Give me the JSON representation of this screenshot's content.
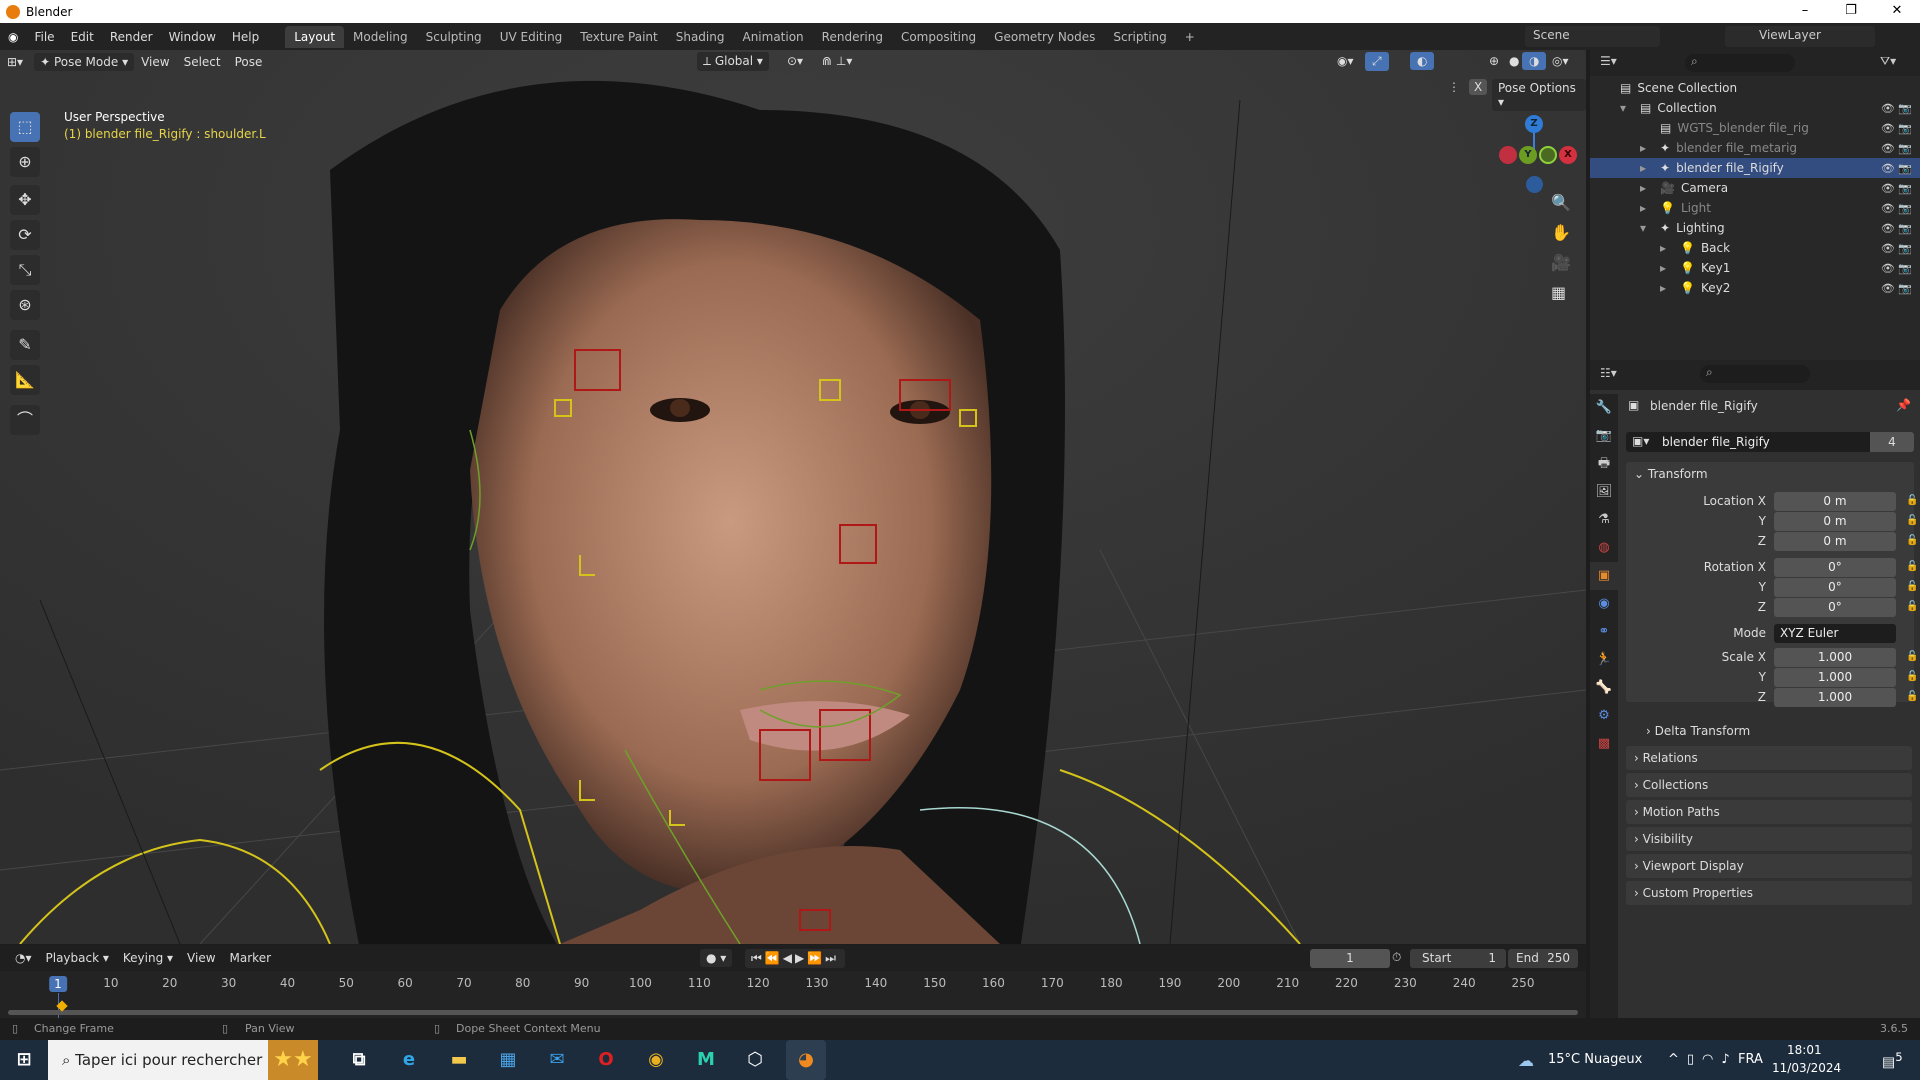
{
  "window": {
    "title": "Blender",
    "minimize": "–",
    "maximize": "❐",
    "close": "✕"
  },
  "menu": [
    "File",
    "Edit",
    "Render",
    "Window",
    "Help"
  ],
  "workspaces": [
    "Layout",
    "Modeling",
    "Sculpting",
    "UV Editing",
    "Texture Paint",
    "Shading",
    "Animation",
    "Rendering",
    "Compositing",
    "Geometry Nodes",
    "Scripting",
    "+"
  ],
  "scene": "Scene",
  "view_layer": "ViewLayer",
  "viewport": {
    "mode": "Pose Mode",
    "menus": [
      "View",
      "Select",
      "Pose"
    ],
    "orientation": "Global",
    "pose_options": "Pose Options",
    "mirror_x": "X",
    "overlay_title": "User Perspective",
    "overlay_subtitle": "(1) blender file_Rigify : shoulder.L",
    "gizmo": {
      "z": "Z",
      "y": "Y",
      "x": "X"
    }
  },
  "outliner": {
    "rows": [
      {
        "label": "Scene Collection",
        "indent": 0
      },
      {
        "label": "Collection",
        "indent": 1
      },
      {
        "label": "WGTS_blender file_rig",
        "indent": 2,
        "dim": true
      },
      {
        "label": "blender file_metarig",
        "indent": 2,
        "dim": true
      },
      {
        "label": "blender file_Rigify",
        "indent": 2,
        "selected": true
      },
      {
        "label": "Camera",
        "indent": 2
      },
      {
        "label": "Light",
        "indent": 2,
        "dim": true
      },
      {
        "label": "Lighting",
        "indent": 2
      },
      {
        "label": "Back",
        "indent": 3
      },
      {
        "label": "Key1",
        "indent": 3
      },
      {
        "label": "Key2",
        "indent": 3
      }
    ]
  },
  "properties": {
    "object_name": "blender file_Rigify",
    "data_name": "blender file_Rigify",
    "users": "4",
    "transform_label": "Transform",
    "fields": [
      {
        "label": "Location X",
        "value": "0 m"
      },
      {
        "label": "Y",
        "value": "0 m"
      },
      {
        "label": "Z",
        "value": "0 m"
      },
      {
        "label": "Rotation X",
        "value": "0°"
      },
      {
        "label": "Y",
        "value": "0°"
      },
      {
        "label": "Z",
        "value": "0°"
      },
      {
        "label": "Mode",
        "value": "XYZ Euler"
      },
      {
        "label": "Scale X",
        "value": "1.000"
      },
      {
        "label": "Y",
        "value": "1.000"
      },
      {
        "label": "Z",
        "value": "1.000"
      }
    ],
    "delta": "Delta Transform",
    "panels": [
      "Relations",
      "Collections",
      "Motion Paths",
      "Visibility",
      "Viewport Display",
      "Custom Properties"
    ]
  },
  "timeline": {
    "menus": [
      "Playback",
      "Keying",
      "View",
      "Marker"
    ],
    "current_frame": "1",
    "start_label": "Start",
    "start": "1",
    "end_label": "End",
    "end": "250",
    "ticks": [
      "1",
      "10",
      "20",
      "30",
      "40",
      "50",
      "60",
      "70",
      "80",
      "90",
      "100",
      "110",
      "120",
      "130",
      "140",
      "150",
      "160",
      "170",
      "180",
      "190",
      "200",
      "210",
      "220",
      "230",
      "240",
      "250"
    ]
  },
  "status": {
    "left": "Change Frame",
    "middle": "Pan View",
    "right": "Dope Sheet Context Menu",
    "version": "3.6.5"
  },
  "taskbar": {
    "search": "Taper ici pour rechercher",
    "weather": "15°C  Nuageux",
    "lang": "FRA",
    "time": "18:01",
    "date": "11/03/2024",
    "notif": "5"
  },
  "colors": {
    "accent": "#4772b3",
    "selected_row": "#334d80",
    "bone_yellow": "#d4c31a",
    "bone_red": "#b01818",
    "bone_green": "#6ea02a"
  }
}
